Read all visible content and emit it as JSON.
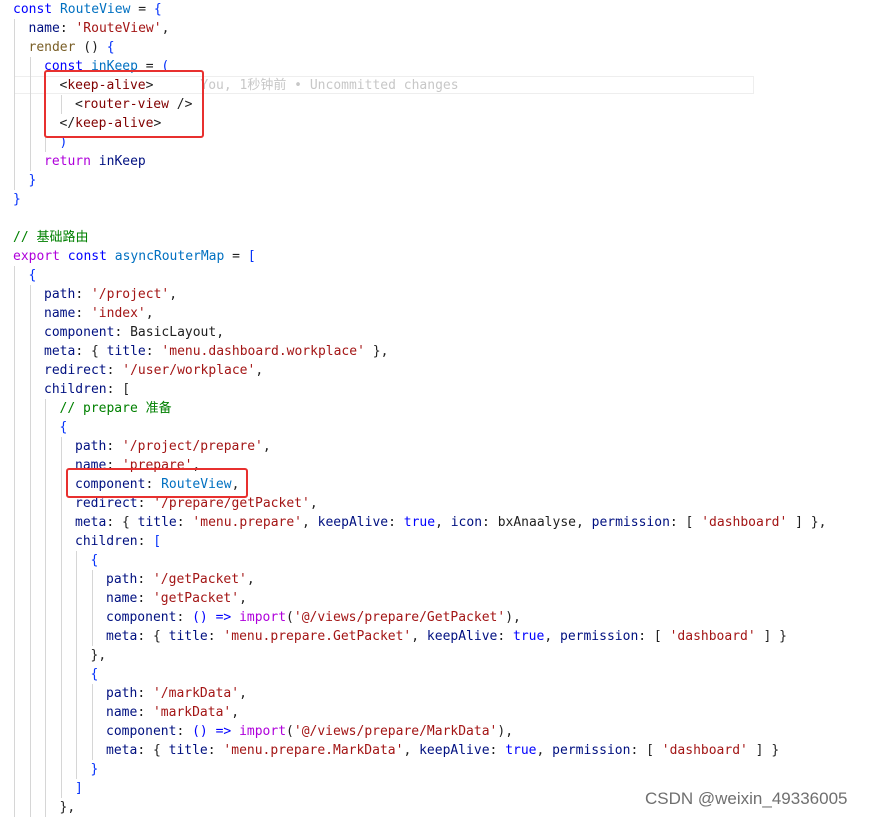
{
  "editor": {
    "lines": [
      [
        {
          "t": "const ",
          "c": "kw"
        },
        {
          "t": "RouteView",
          "c": "def"
        },
        {
          "t": " = ",
          "c": "pun"
        },
        {
          "t": "{",
          "c": "br"
        }
      ],
      [
        {
          "t": "name",
          "c": "var"
        },
        {
          "t": ": ",
          "c": "pun"
        },
        {
          "t": "'RouteView'",
          "c": "str"
        },
        {
          "t": ",",
          "c": "pun"
        }
      ],
      [
        {
          "t": "render",
          "c": "fn"
        },
        {
          "t": " () ",
          "c": "pun"
        },
        {
          "t": "{",
          "c": "br"
        }
      ],
      [
        {
          "t": "const ",
          "c": "kw"
        },
        {
          "t": "inKeep",
          "c": "def"
        },
        {
          "t": " = ",
          "c": "pun"
        },
        {
          "t": "(",
          "c": "br"
        }
      ],
      [
        {
          "t": "<",
          "c": "pun"
        },
        {
          "t": "keep-alive",
          "c": "tag"
        },
        {
          "t": ">",
          "c": "pun"
        },
        {
          "t": "      You, 1秒钟前 • Uncommitted changes",
          "c": "ghost"
        }
      ],
      [
        {
          "t": "<",
          "c": "pun"
        },
        {
          "t": "router-view",
          "c": "tag"
        },
        {
          "t": " />",
          "c": "pun"
        }
      ],
      [
        {
          "t": "</",
          "c": "pun"
        },
        {
          "t": "keep-alive",
          "c": "tag"
        },
        {
          "t": ">",
          "c": "pun"
        }
      ],
      [
        {
          "t": ")",
          "c": "br"
        }
      ],
      [
        {
          "t": "return ",
          "c": "ctrl"
        },
        {
          "t": "inKeep",
          "c": "var"
        }
      ],
      [
        {
          "t": "}",
          "c": "br"
        }
      ],
      [
        {
          "t": "}",
          "c": "br"
        }
      ],
      [],
      [
        {
          "t": "// 基础路由",
          "c": "com"
        }
      ],
      [
        {
          "t": "export ",
          "c": "ctrl"
        },
        {
          "t": "const ",
          "c": "kw"
        },
        {
          "t": "asyncRouterMap",
          "c": "def"
        },
        {
          "t": " = ",
          "c": "pun"
        },
        {
          "t": "[",
          "c": "br"
        }
      ],
      [
        {
          "t": "{",
          "c": "br"
        }
      ],
      [
        {
          "t": "path",
          "c": "var"
        },
        {
          "t": ": ",
          "c": "pun"
        },
        {
          "t": "'/project'",
          "c": "str"
        },
        {
          "t": ",",
          "c": "pun"
        }
      ],
      [
        {
          "t": "name",
          "c": "var"
        },
        {
          "t": ": ",
          "c": "pun"
        },
        {
          "t": "'index'",
          "c": "str"
        },
        {
          "t": ",",
          "c": "pun"
        }
      ],
      [
        {
          "t": "component",
          "c": "var"
        },
        {
          "t": ": BasicLayout,",
          "c": "pun"
        }
      ],
      [
        {
          "t": "meta",
          "c": "var"
        },
        {
          "t": ": { ",
          "c": "pun"
        },
        {
          "t": "title",
          "c": "var"
        },
        {
          "t": ": ",
          "c": "pun"
        },
        {
          "t": "'menu.dashboard.workplace'",
          "c": "str"
        },
        {
          "t": " },",
          "c": "pun"
        }
      ],
      [
        {
          "t": "redirect",
          "c": "var"
        },
        {
          "t": ": ",
          "c": "pun"
        },
        {
          "t": "'/user/workplace'",
          "c": "str"
        },
        {
          "t": ",",
          "c": "pun"
        }
      ],
      [
        {
          "t": "children",
          "c": "var"
        },
        {
          "t": ": [",
          "c": "pun"
        }
      ],
      [
        {
          "t": "// prepare 准备",
          "c": "com"
        }
      ],
      [
        {
          "t": "{",
          "c": "br"
        }
      ],
      [
        {
          "t": "path",
          "c": "var"
        },
        {
          "t": ": ",
          "c": "pun"
        },
        {
          "t": "'/project/prepare'",
          "c": "str"
        },
        {
          "t": ",",
          "c": "pun"
        }
      ],
      [
        {
          "t": "name",
          "c": "var"
        },
        {
          "t": ": ",
          "c": "pun"
        },
        {
          "t": "'prepare'",
          "c": "str"
        },
        {
          "t": ",",
          "c": "pun"
        }
      ],
      [
        {
          "t": "component",
          "c": "var"
        },
        {
          "t": ": ",
          "c": "pun"
        },
        {
          "t": "RouteView",
          "c": "def"
        },
        {
          "t": ",",
          "c": "pun"
        }
      ],
      [
        {
          "t": "redirect",
          "c": "var"
        },
        {
          "t": ": ",
          "c": "pun"
        },
        {
          "t": "'/prepare/getPacket'",
          "c": "str"
        },
        {
          "t": ",",
          "c": "pun"
        }
      ],
      [
        {
          "t": "meta",
          "c": "var"
        },
        {
          "t": ": { ",
          "c": "pun"
        },
        {
          "t": "title",
          "c": "var"
        },
        {
          "t": ": ",
          "c": "pun"
        },
        {
          "t": "'menu.prepare'",
          "c": "str"
        },
        {
          "t": ", ",
          "c": "pun"
        },
        {
          "t": "keepAlive",
          "c": "var"
        },
        {
          "t": ": ",
          "c": "pun"
        },
        {
          "t": "true",
          "c": "kw"
        },
        {
          "t": ", ",
          "c": "pun"
        },
        {
          "t": "icon",
          "c": "var"
        },
        {
          "t": ": bxAnaalyse, ",
          "c": "pun"
        },
        {
          "t": "permission",
          "c": "var"
        },
        {
          "t": ": [ ",
          "c": "pun"
        },
        {
          "t": "'dashboard'",
          "c": "str"
        },
        {
          "t": " ] },",
          "c": "pun"
        }
      ],
      [
        {
          "t": "children",
          "c": "var"
        },
        {
          "t": ": ",
          "c": "pun"
        },
        {
          "t": "[",
          "c": "br"
        }
      ],
      [
        {
          "t": "{",
          "c": "br"
        }
      ],
      [
        {
          "t": "path",
          "c": "var"
        },
        {
          "t": ": ",
          "c": "pun"
        },
        {
          "t": "'/getPacket'",
          "c": "str"
        },
        {
          "t": ",",
          "c": "pun"
        }
      ],
      [
        {
          "t": "name",
          "c": "var"
        },
        {
          "t": ": ",
          "c": "pun"
        },
        {
          "t": "'getPacket'",
          "c": "str"
        },
        {
          "t": ",",
          "c": "pun"
        }
      ],
      [
        {
          "t": "component",
          "c": "var"
        },
        {
          "t": ": ",
          "c": "pun"
        },
        {
          "t": "() =>",
          "c": "kw"
        },
        {
          "t": " ",
          "c": "pun"
        },
        {
          "t": "import",
          "c": "ctrl"
        },
        {
          "t": "(",
          "c": "pun"
        },
        {
          "t": "'@/views/prepare/GetPacket'",
          "c": "str"
        },
        {
          "t": "),",
          "c": "pun"
        }
      ],
      [
        {
          "t": "meta",
          "c": "var"
        },
        {
          "t": ": { ",
          "c": "pun"
        },
        {
          "t": "title",
          "c": "var"
        },
        {
          "t": ": ",
          "c": "pun"
        },
        {
          "t": "'menu.prepare.GetPacket'",
          "c": "str"
        },
        {
          "t": ", ",
          "c": "pun"
        },
        {
          "t": "keepAlive",
          "c": "var"
        },
        {
          "t": ": ",
          "c": "pun"
        },
        {
          "t": "true",
          "c": "kw"
        },
        {
          "t": ", ",
          "c": "pun"
        },
        {
          "t": "permission",
          "c": "var"
        },
        {
          "t": ": [ ",
          "c": "pun"
        },
        {
          "t": "'dashboard'",
          "c": "str"
        },
        {
          "t": " ] }",
          "c": "pun"
        }
      ],
      [
        {
          "t": "},",
          "c": "pun"
        }
      ],
      [
        {
          "t": "{",
          "c": "br"
        }
      ],
      [
        {
          "t": "path",
          "c": "var"
        },
        {
          "t": ": ",
          "c": "pun"
        },
        {
          "t": "'/markData'",
          "c": "str"
        },
        {
          "t": ",",
          "c": "pun"
        }
      ],
      [
        {
          "t": "name",
          "c": "var"
        },
        {
          "t": ": ",
          "c": "pun"
        },
        {
          "t": "'markData'",
          "c": "str"
        },
        {
          "t": ",",
          "c": "pun"
        }
      ],
      [
        {
          "t": "component",
          "c": "var"
        },
        {
          "t": ": ",
          "c": "pun"
        },
        {
          "t": "() =>",
          "c": "kw"
        },
        {
          "t": " ",
          "c": "pun"
        },
        {
          "t": "import",
          "c": "ctrl"
        },
        {
          "t": "(",
          "c": "pun"
        },
        {
          "t": "'@/views/prepare/MarkData'",
          "c": "str"
        },
        {
          "t": "),",
          "c": "pun"
        }
      ],
      [
        {
          "t": "meta",
          "c": "var"
        },
        {
          "t": ": { ",
          "c": "pun"
        },
        {
          "t": "title",
          "c": "var"
        },
        {
          "t": ": ",
          "c": "pun"
        },
        {
          "t": "'menu.prepare.MarkData'",
          "c": "str"
        },
        {
          "t": ", ",
          "c": "pun"
        },
        {
          "t": "keepAlive",
          "c": "var"
        },
        {
          "t": ": ",
          "c": "pun"
        },
        {
          "t": "true",
          "c": "kw"
        },
        {
          "t": ", ",
          "c": "pun"
        },
        {
          "t": "permission",
          "c": "var"
        },
        {
          "t": ": [ ",
          "c": "pun"
        },
        {
          "t": "'dashboard'",
          "c": "str"
        },
        {
          "t": " ] }",
          "c": "pun"
        }
      ],
      [
        {
          "t": "}",
          "c": "br"
        }
      ],
      [
        {
          "t": "]",
          "c": "br"
        }
      ],
      [
        {
          "t": "},",
          "c": "pun"
        }
      ]
    ]
  },
  "colors": {
    "highlight_box": "#e8302f",
    "background": "#ffffff"
  },
  "watermark": "CSDN @weixin_49336005"
}
